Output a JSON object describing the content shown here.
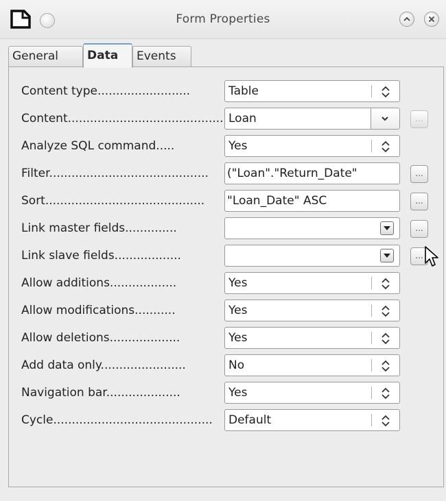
{
  "window": {
    "title": "Form Properties"
  },
  "tabs": [
    {
      "label": "General"
    },
    {
      "label": "Data"
    },
    {
      "label": "Events"
    }
  ],
  "rows": [
    {
      "label": "Content type.........................",
      "value": "Table"
    },
    {
      "label": "Content...........................................",
      "value": "Loan",
      "button": "..."
    },
    {
      "label": "Analyze SQL command.....",
      "value": "Yes"
    },
    {
      "label": "Filter...........................................",
      "value": "(\"Loan\".\"Return_Date\"",
      "button": "..."
    },
    {
      "label": "Sort...........................................",
      "value": "\"Loan_Date\" ASC",
      "button": "..."
    },
    {
      "label": "Link master fields..............",
      "value": "",
      "button": "..."
    },
    {
      "label": "Link slave fields..................",
      "value": "",
      "button": "..."
    },
    {
      "label": "Allow additions..................",
      "value": "Yes"
    },
    {
      "label": "Allow modifications...........",
      "value": "Yes"
    },
    {
      "label": "Allow deletions...................",
      "value": "Yes"
    },
    {
      "label": "Add data only.......................",
      "value": "No"
    },
    {
      "label": "Navigation bar....................",
      "value": "Yes"
    },
    {
      "label": "Cycle...........................................",
      "value": "Default"
    }
  ],
  "icons": {
    "app": "document-icon",
    "minimize": "circle-button-icon",
    "shade": "shade-up-icon",
    "close": "close-icon",
    "cursor": "mouse-pointer-icon"
  },
  "colors": {
    "active_tab_accent": "#7a9cc8"
  }
}
